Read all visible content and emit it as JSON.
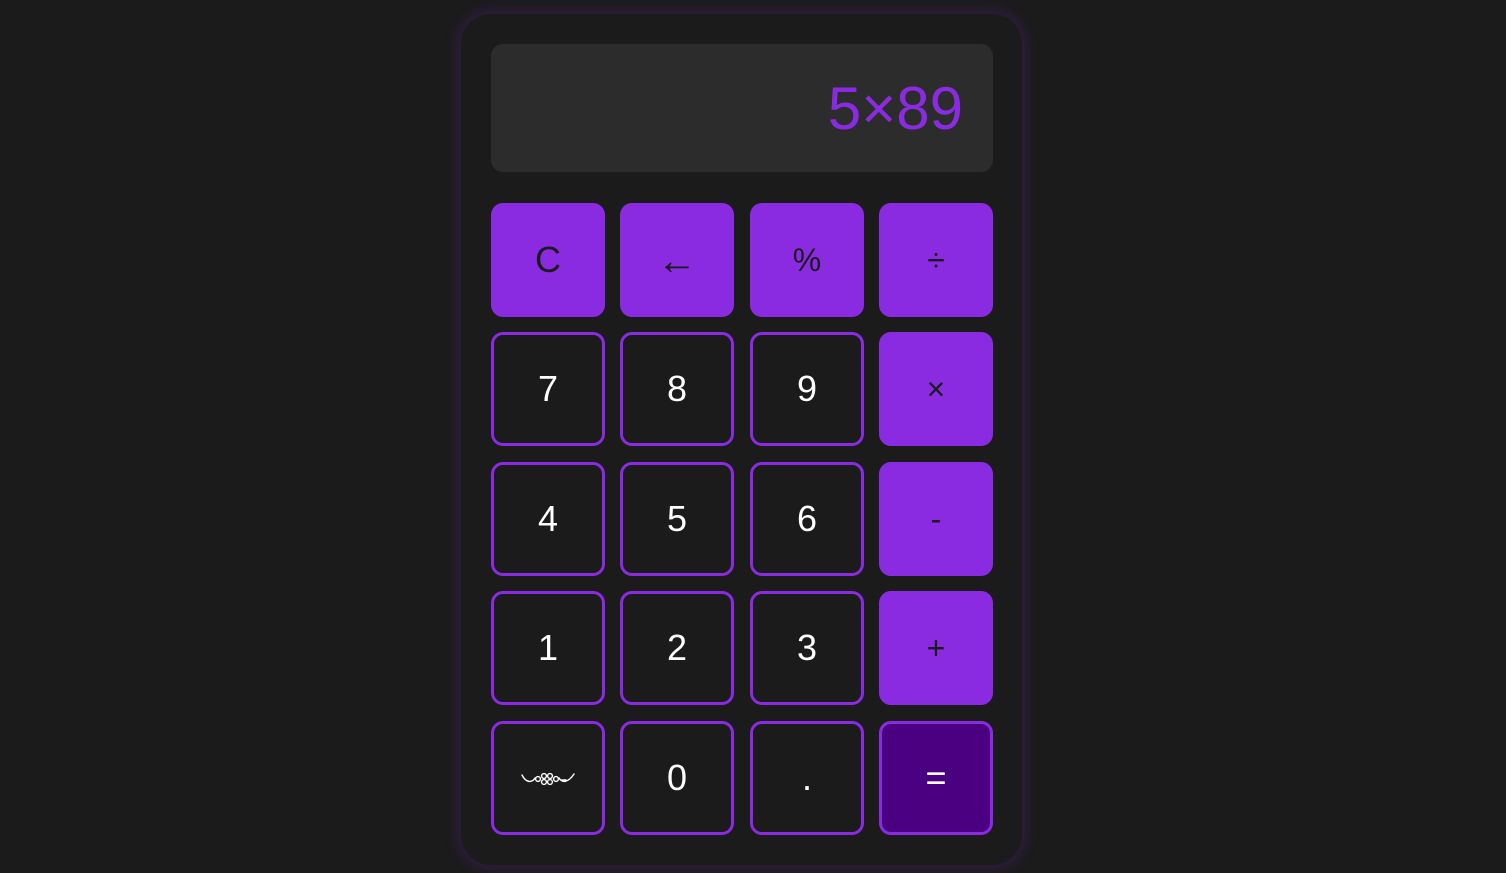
{
  "display": {
    "expression": "5×89"
  },
  "keys": {
    "clear": "C",
    "backspace": "←",
    "percent": "%",
    "divide": "÷",
    "seven": "7",
    "eight": "8",
    "nine": "9",
    "multiply": "×",
    "four": "4",
    "five": "5",
    "six": "6",
    "subtract": "-",
    "one": "1",
    "two": "2",
    "three": "3",
    "add": "+",
    "zero": "0",
    "decimal": ".",
    "equals": "="
  },
  "icons": {
    "ornament_key": "ornament-flourish-icon"
  },
  "colors": {
    "background": "#1b1b1b",
    "display_background": "#2c2c2c",
    "accent": "#8a2be2",
    "equals_background": "#4b0082",
    "digit_text": "#ffffff"
  }
}
